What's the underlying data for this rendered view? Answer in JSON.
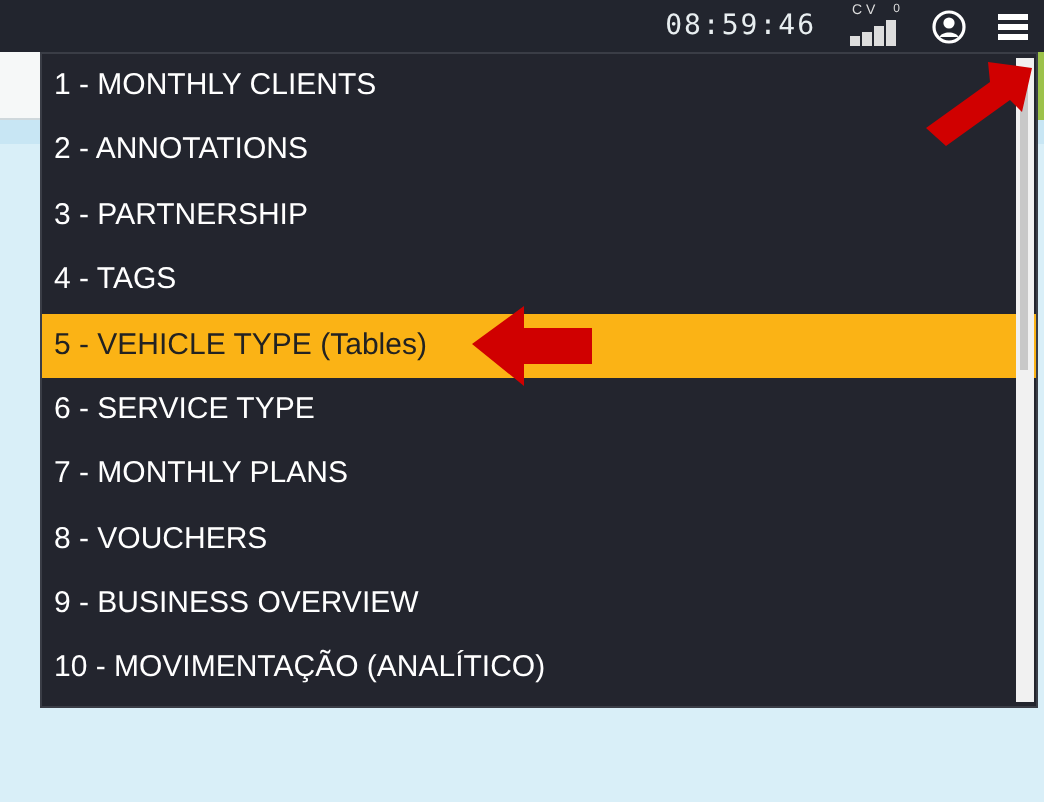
{
  "top_bar": {
    "time": "08:59:46",
    "signal_label": "CV",
    "signal_count": "0"
  },
  "menu": {
    "items": [
      {
        "label": "1 - MONTHLY CLIENTS",
        "selected": false
      },
      {
        "label": "2 - ANNOTATIONS",
        "selected": false
      },
      {
        "label": "3 - PARTNERSHIP",
        "selected": false
      },
      {
        "label": "4 - TAGS",
        "selected": false
      },
      {
        "label": "5 - VEHICLE TYPE (Tables)",
        "selected": true
      },
      {
        "label": "6 - SERVICE TYPE",
        "selected": false
      },
      {
        "label": "7 - MONTHLY PLANS",
        "selected": false
      },
      {
        "label": "8 - VOUCHERS",
        "selected": false
      },
      {
        "label": "9 - BUSINESS OVERVIEW",
        "selected": false
      },
      {
        "label": "10 - MOVIMENTAÇÃO (ANALÍTICO)",
        "selected": false
      }
    ]
  }
}
